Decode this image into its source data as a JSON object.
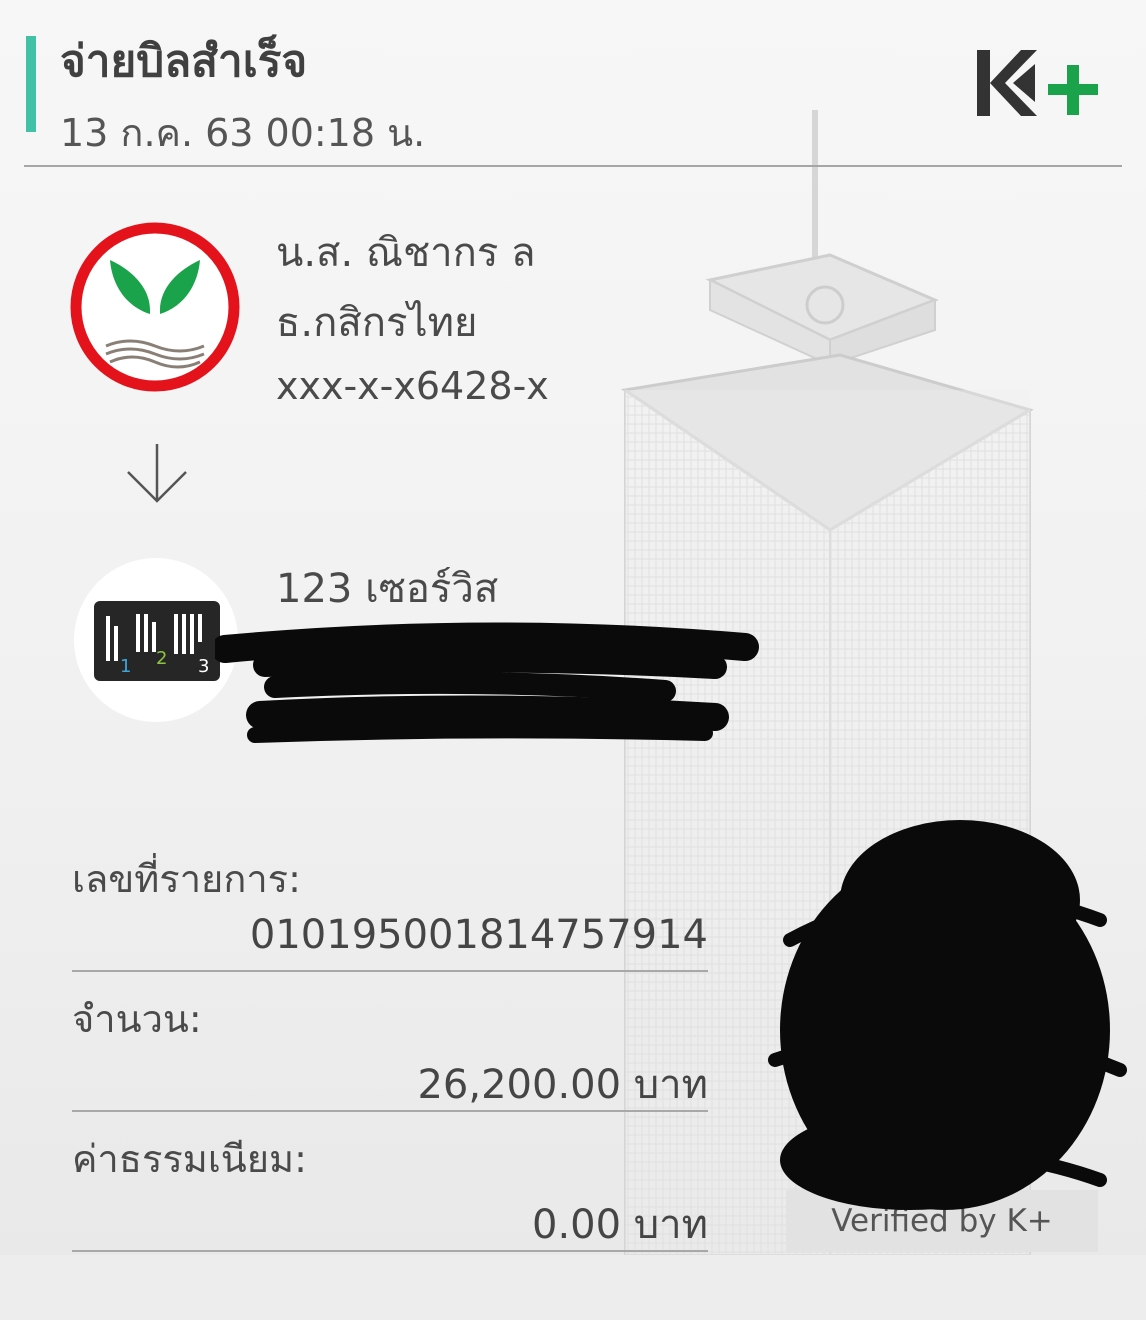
{
  "header": {
    "title": "จ่ายบิลสำเร็จ",
    "datetime": "13 ก.ค. 63  00:18 น.",
    "brand_logo": "K+"
  },
  "sender": {
    "bank_logo_icon": "kasikorn-bank-logo-icon",
    "name": "น.ส. ณิชากร ล",
    "bank": "ธ.กสิกรไทย",
    "account": "xxx-x-x6428-x"
  },
  "transfer_direction_icon": "arrow-down-icon",
  "biller": {
    "logo_icon": "123-service-logo-icon",
    "name": "123 เซอร์วิส",
    "details_redacted": true
  },
  "details": {
    "ref_label": "เลขที่รายการ:",
    "ref_value": "010195001814757914",
    "amount_label": "จำนวน:",
    "amount_value": "26,200.00 บาท",
    "fee_label": "ค่าธรรมเนียม:",
    "fee_value": "0.00 บาท"
  },
  "qr": {
    "redacted": true,
    "verified_text": "Verified by K+"
  },
  "colors": {
    "accent_teal": "#41c2a6",
    "kbank_green": "#1aa34a",
    "kbank_red": "#e3121b",
    "k_dark": "#333333"
  }
}
